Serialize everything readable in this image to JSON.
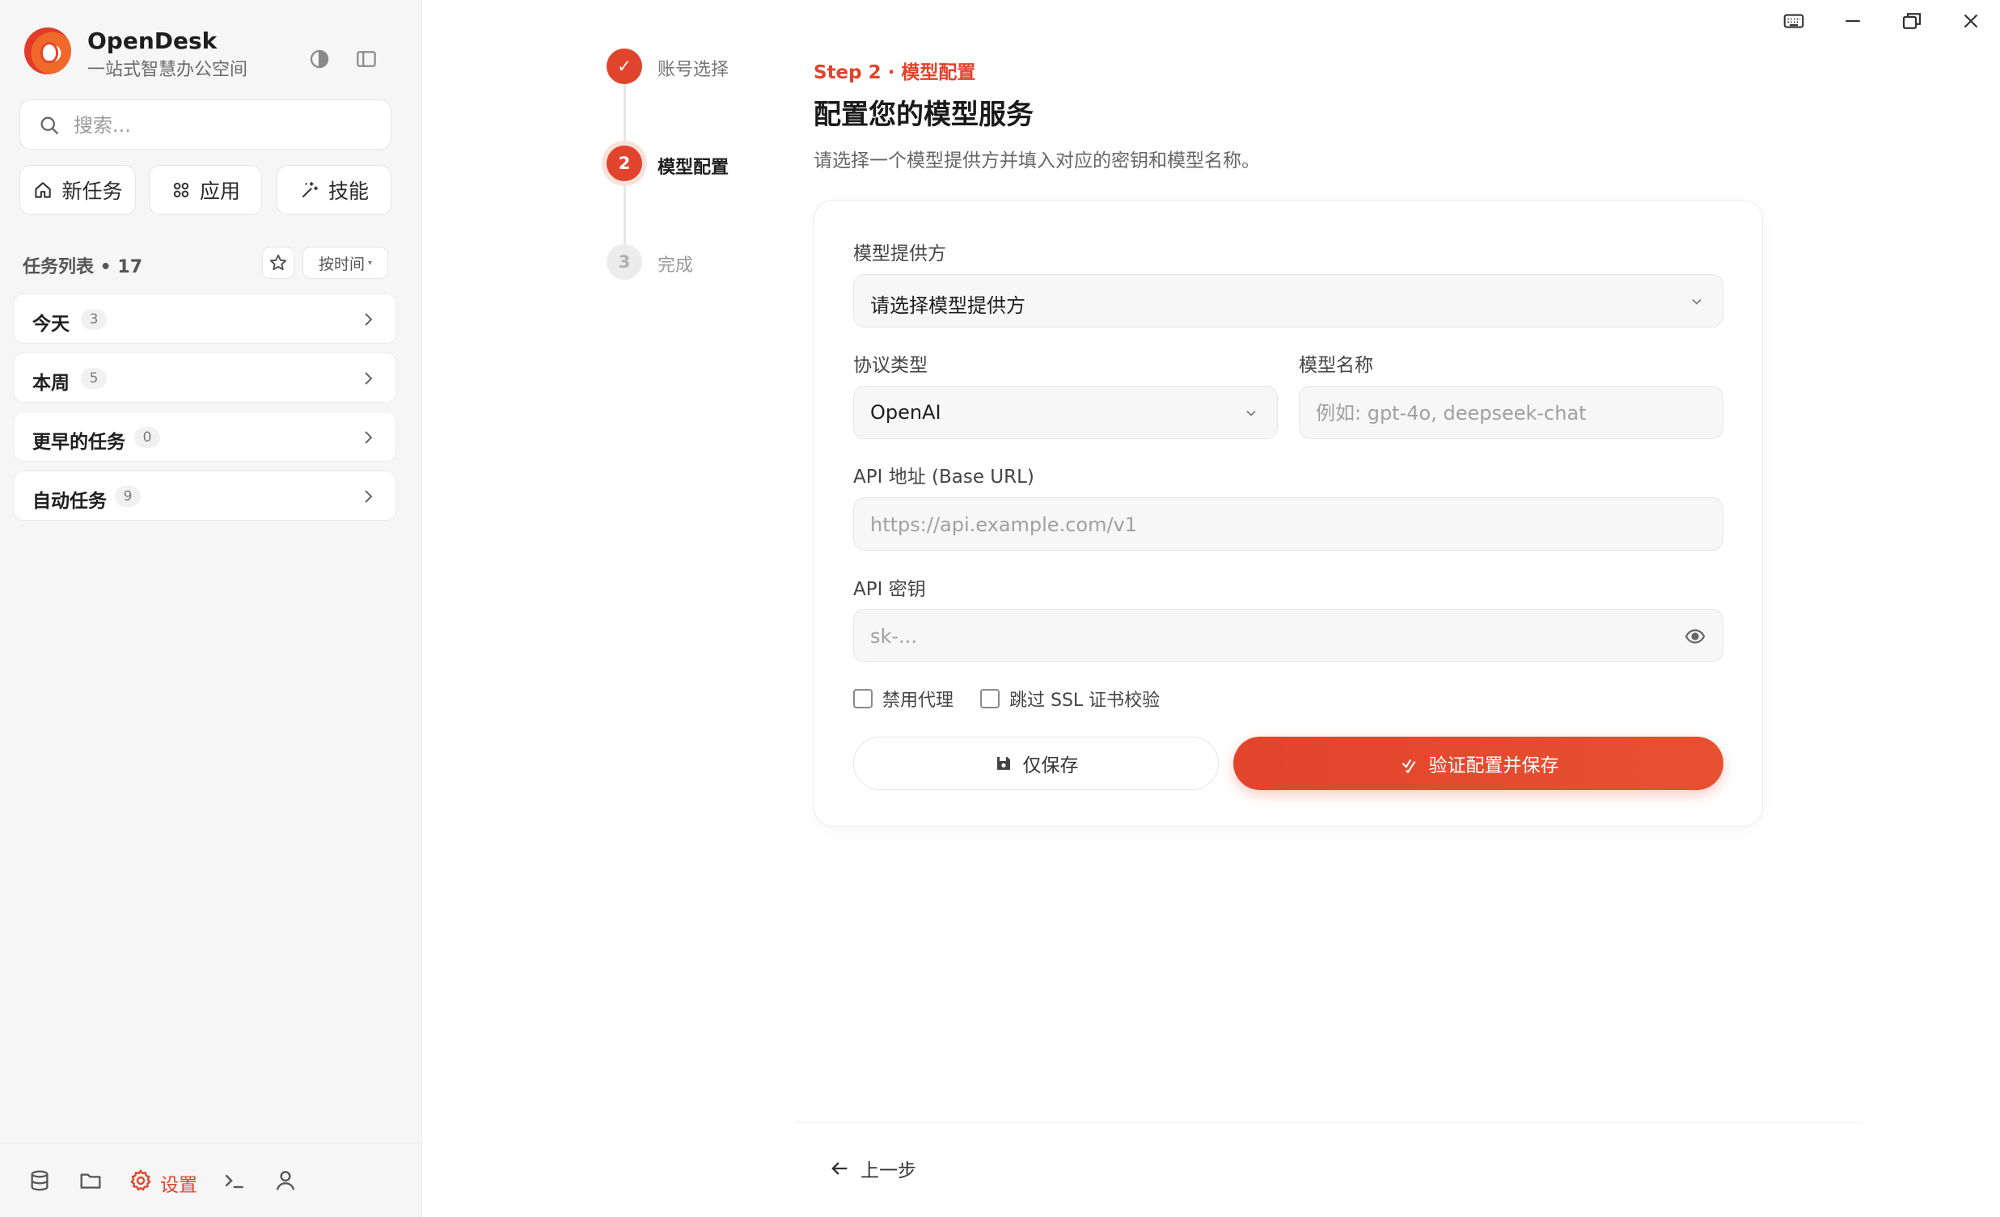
{
  "app": {
    "name": "OpenDesk",
    "subtitle": "一站式智慧办公空间"
  },
  "search": {
    "placeholder": "搜索..."
  },
  "quick_actions": [
    {
      "label": "新任务",
      "icon": "home-icon"
    },
    {
      "label": "应用",
      "icon": "grid-icon"
    },
    {
      "label": "技能",
      "icon": "sparkle-icon"
    }
  ],
  "task_list": {
    "title": "任务列表 • 17",
    "sort_label": "按时间",
    "groups": [
      {
        "label": "今天",
        "count": "3"
      },
      {
        "label": "本周",
        "count": "5"
      },
      {
        "label": "更早的任务",
        "count": "0"
      },
      {
        "label": "自动任务",
        "count": "9"
      }
    ]
  },
  "bottom_bar": {
    "settings_label": "设置"
  },
  "stepper": {
    "steps": [
      {
        "number": "✓",
        "label": "账号选择",
        "state": "done"
      },
      {
        "number": "2",
        "label": "模型配置",
        "state": "active"
      },
      {
        "number": "3",
        "label": "完成",
        "state": "todo"
      }
    ]
  },
  "main": {
    "kicker": "Step 2 · 模型配置",
    "title": "配置您的模型服务",
    "description": "请选择一个模型提供方并填入对应的密钥和模型名称。"
  },
  "form": {
    "provider": {
      "label": "模型提供方",
      "value": "请选择模型提供方"
    },
    "protocol": {
      "label": "协议类型",
      "value": "OpenAI"
    },
    "model_name": {
      "label": "模型名称",
      "placeholder": "例如: gpt-4o, deepseek-chat"
    },
    "base_url": {
      "label": "API 地址 (Base URL)",
      "placeholder": "https://api.example.com/v1"
    },
    "api_key": {
      "label": "API 密钥",
      "placeholder": "sk-..."
    },
    "disable_proxy": {
      "label": "禁用代理",
      "checked": false
    },
    "skip_ssl": {
      "label": "跳过 SSL 证书校验",
      "checked": false
    },
    "save_label": "仅保存",
    "verify_label": "验证配置并保存"
  },
  "footer": {
    "back_label": "上一步"
  },
  "colors": {
    "accent": "#e0442c",
    "sidebar_bg": "#f6f6f6",
    "field_bg": "#f7f7f7"
  }
}
